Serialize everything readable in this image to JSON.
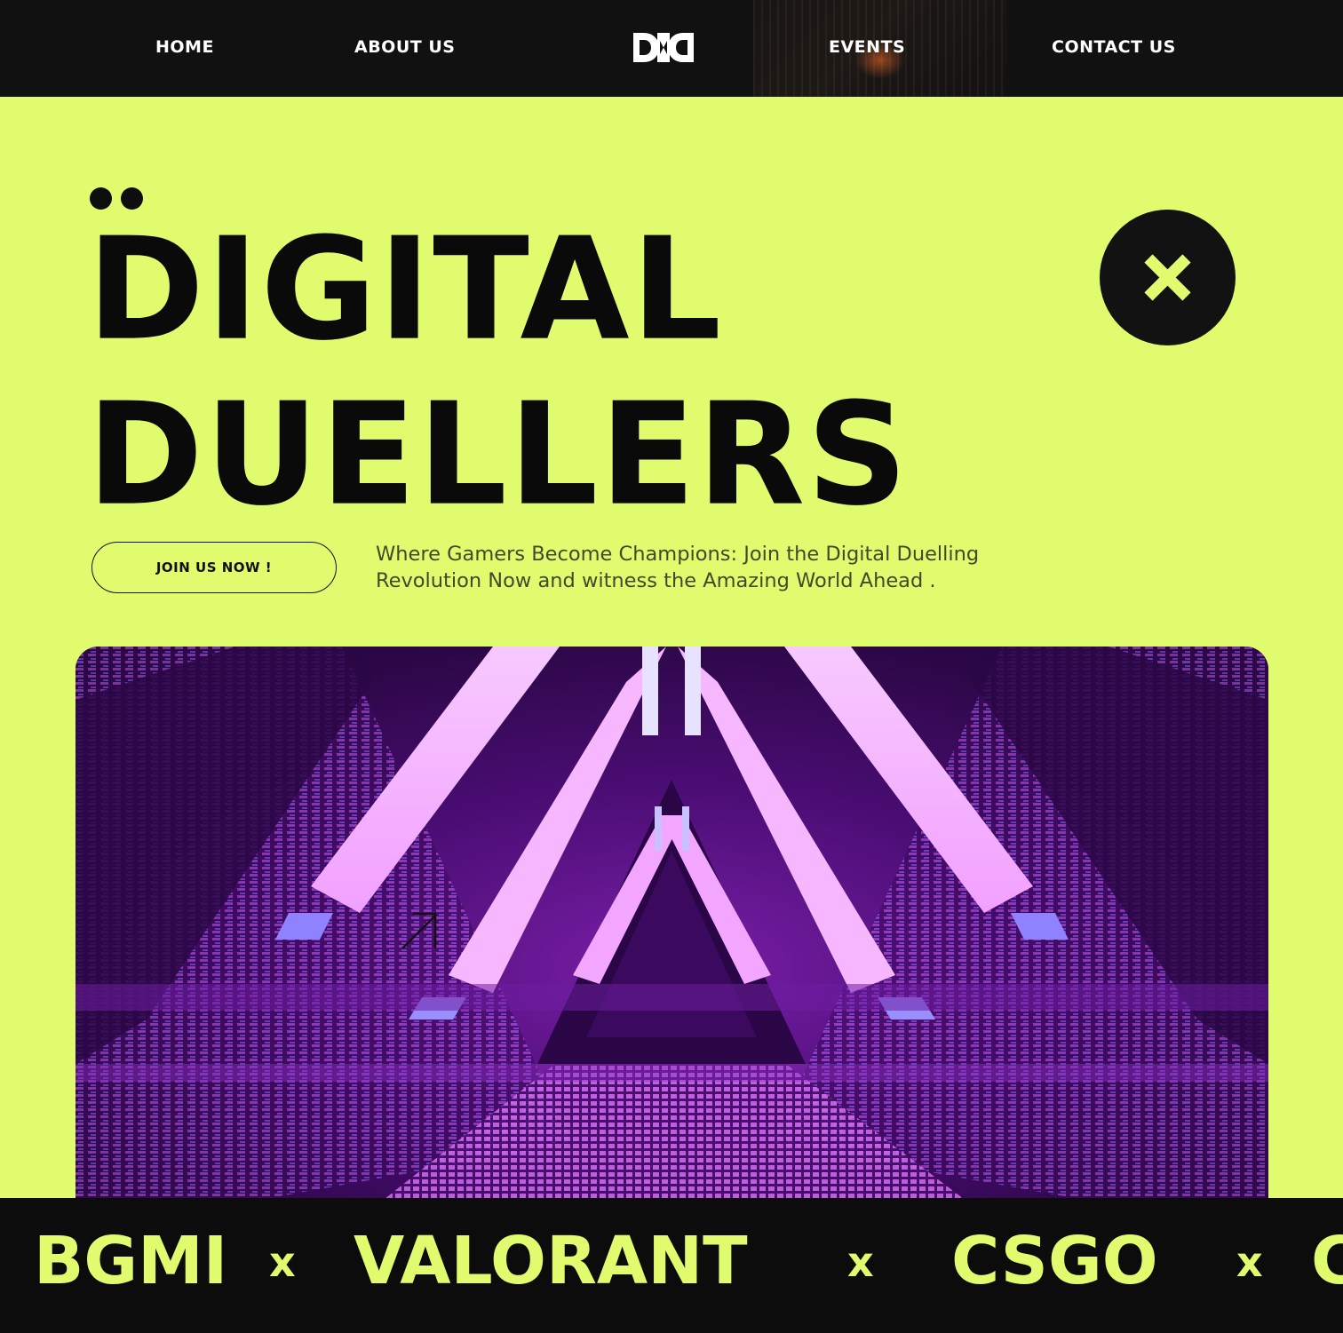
{
  "nav": {
    "links": [
      {
        "label": "HOME"
      },
      {
        "label": "ABOUT US"
      },
      {
        "label": "EVENTS"
      },
      {
        "label": "CONTACT US"
      }
    ],
    "logo_icon": "dd-monogram-logo"
  },
  "hero": {
    "title_line_1": "DIGITAL",
    "title_line_2": "DUELLERS",
    "close_icon": "close-icon",
    "cta_label": "JOIN US NOW !",
    "tagline": "Where Gamers Become Champions: Join the Digital Duelling Revolution Now and witness the Amazing World Ahead ."
  },
  "media": {
    "cursor_icon": "arrow-up-right-icon"
  },
  "marquee": {
    "items": [
      "BGMI",
      "VALORANT",
      "CSGO",
      "C"
    ],
    "separator": "x"
  },
  "colors": {
    "accent": "#e0fb6e",
    "dark": "#111111",
    "neon_purple": "#b04ad8",
    "neon_blue": "#8a7dff"
  }
}
